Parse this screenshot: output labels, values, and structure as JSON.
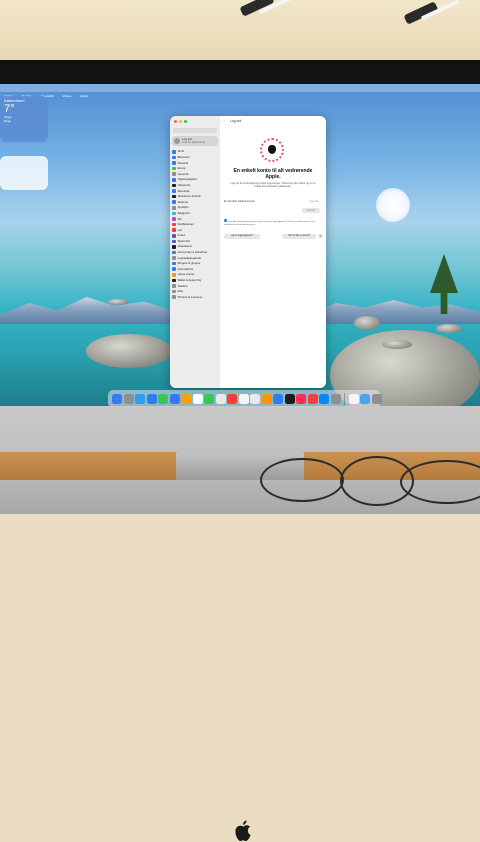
{
  "menubar": {
    "items": [
      "Vælger",
      "Rediger",
      "Overskrift",
      "Vindue",
      "Hjælp"
    ]
  },
  "weather_widget": {
    "city": "København",
    "temp": "7°",
    "label_a": "Skyet",
    "label_b": "Regn"
  },
  "settings_window": {
    "title": "Log ind",
    "account_label": "Log ind",
    "account_sub": "med din Apple-konto",
    "sidebar": [
      {
        "label": "Wi-Fi",
        "color": "#2f7cf6",
        "icon": "wifi-icon"
      },
      {
        "label": "Bluetooth",
        "color": "#2f7cf6",
        "icon": "bluetooth-icon"
      },
      {
        "label": "Netværk",
        "color": "#2f7cf6",
        "icon": "globe-icon"
      },
      {
        "label": "Energi",
        "color": "#34c759",
        "icon": "battery-icon"
      },
      {
        "label": "Generelt",
        "color": "#8e8e93",
        "icon": "gear-icon"
      },
      {
        "label": "Tilgængelighed",
        "color": "#2f7cf6",
        "icon": "accessibility-icon"
      },
      {
        "label": "Udseende",
        "color": "#1c1c1e",
        "icon": "appearance-icon"
      },
      {
        "label": "Menulinje",
        "color": "#2f7cf6",
        "icon": "menubar-icon"
      },
      {
        "label": "Skrivebord & Dock",
        "color": "#1c1c1e",
        "icon": "dock-icon"
      },
      {
        "label": "Skærme",
        "color": "#2f7cf6",
        "icon": "display-icon"
      },
      {
        "label": "Spotlight",
        "color": "#8e8e93",
        "icon": "spotlight-icon"
      },
      {
        "label": "Baggrund",
        "color": "#2fb5f6",
        "icon": "wallpaper-icon"
      },
      {
        "label": "Siri",
        "color": "#c243d6",
        "icon": "siri-icon"
      },
      {
        "label": "Notifikationer",
        "color": "#ff3b30",
        "icon": "bell-icon"
      },
      {
        "label": "Lyd",
        "color": "#ff3b30",
        "icon": "sound-icon"
      },
      {
        "label": "Fokus",
        "color": "#5856d6",
        "icon": "moon-icon"
      },
      {
        "label": "Skærmtid",
        "color": "#5856d6",
        "icon": "hourglass-icon"
      },
      {
        "label": "Låseskærm",
        "color": "#1c1c1e",
        "icon": "lock-icon"
      },
      {
        "label": "Anonymitet & sikkerhed",
        "color": "#2f7cf6",
        "icon": "hand-icon"
      },
      {
        "label": "Loginadgangskode",
        "color": "#8e8e93",
        "icon": "key-icon"
      },
      {
        "label": "Brugere & grupper",
        "color": "#2f7cf6",
        "icon": "users-icon"
      },
      {
        "label": "Internetkonti",
        "color": "#2f7cf6",
        "icon": "at-icon"
      },
      {
        "label": "Game Center",
        "color": "#ff9500",
        "icon": "gamecenter-icon"
      },
      {
        "label": "Wallet & Apple Pay",
        "color": "#1c1c1e",
        "icon": "wallet-icon"
      },
      {
        "label": "Tastatur",
        "color": "#8e8e93",
        "icon": "keyboard-icon"
      },
      {
        "label": "Mus",
        "color": "#8e8e93",
        "icon": "mouse-icon"
      },
      {
        "label": "Printere & scannere",
        "color": "#8e8e93",
        "icon": "printer-icon"
      }
    ],
    "headline": "En enkelt konto til alt vedrørende Apple.",
    "description": "Log ind for at få adgang til dine oplysninger i iCloud og App Store og for at holde dine enheder opdaterede.",
    "field_label": "E-mail eller telefonnummer",
    "field_value": "Log ind",
    "continue_label": "Fortsæt",
    "privacy_text": "Dine Apple-kontooplysninger bruges til at give dig adgang til iCloud og andre tjenester. Se, hvordan dine data administreres.",
    "forgot_label": "Glemt adgangskode?",
    "create_label": "Har du ikke en konto?",
    "help_label": "?"
  },
  "dock": {
    "colors": [
      "#3a78f5",
      "#8e8e93",
      "#2e9cf5",
      "#2f7cf6",
      "#34c759",
      "#2f7cf6",
      "#ff9f0a",
      "#ffffff",
      "#34c759",
      "#e8e8e8",
      "#ff3b30",
      "#f5f5f5",
      "#e8e8e8",
      "#ff9500",
      "#2f7cf6",
      "#1c1c1e",
      "#ff2d55",
      "#fc3c44",
      "#0a84ff",
      "#8e8e93",
      "#f5f5f5",
      "#4aa3f0",
      "#8e8e93"
    ],
    "icons": [
      "finder-icon",
      "launchpad-icon",
      "safari-icon",
      "mail-icon",
      "messages-icon",
      "maps-icon",
      "photos-icon",
      "calendar-icon",
      "facetime-icon",
      "contacts-icon",
      "reminders-icon",
      "notes-icon",
      "freeform-icon",
      "books-icon",
      "app-store-icon",
      "tv-icon",
      "music-icon",
      "podcasts-icon",
      "keynote-icon",
      "settings-icon",
      "numbers-icon",
      "folder-icon",
      "trash-icon"
    ]
  }
}
